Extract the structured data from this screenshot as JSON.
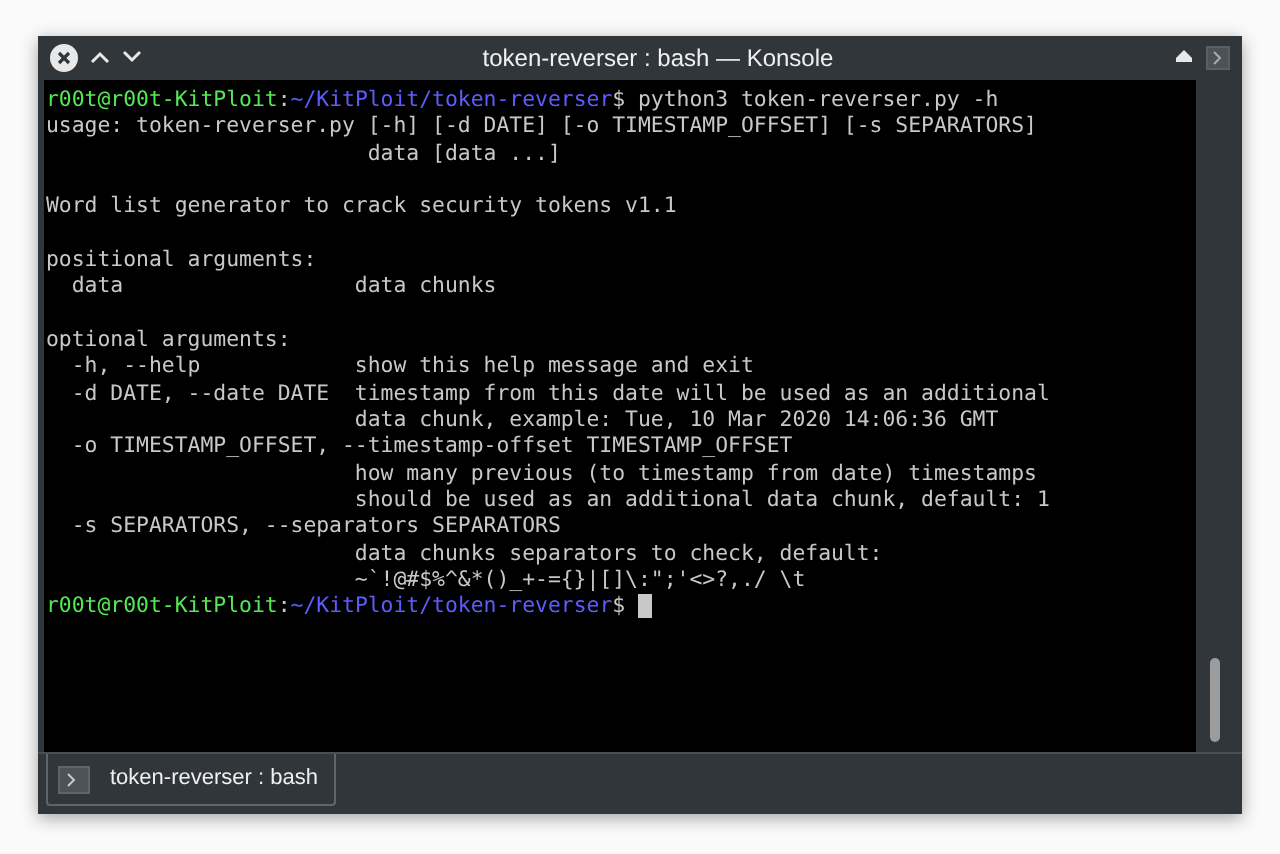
{
  "window": {
    "title": "token-reverser : bash — Konsole"
  },
  "terminal": {
    "lines": [
      {
        "kind": "prompt",
        "user_host": "r00t@r00t-KitPloit",
        "separator": ":",
        "path": "~/KitPloit/token-reverser",
        "prompt_end": "$",
        "command": "python3 token-reverser.py -h",
        "cursor": false
      },
      {
        "kind": "output",
        "text": "usage: token-reverser.py [-h] [-d DATE] [-o TIMESTAMP_OFFSET] [-s SEPARATORS]"
      },
      {
        "kind": "output",
        "text": "                         data [data ...]"
      },
      {
        "kind": "blank"
      },
      {
        "kind": "output",
        "text": "Word list generator to crack security tokens v1.1"
      },
      {
        "kind": "blank"
      },
      {
        "kind": "output",
        "text": "positional arguments:"
      },
      {
        "kind": "output",
        "text": "  data                  data chunks"
      },
      {
        "kind": "blank"
      },
      {
        "kind": "output",
        "text": "optional arguments:"
      },
      {
        "kind": "output",
        "text": "  -h, --help            show this help message and exit"
      },
      {
        "kind": "output",
        "text": "  -d DATE, --date DATE  timestamp from this date will be used as an additional"
      },
      {
        "kind": "output",
        "text": "                        data chunk, example: Tue, 10 Mar 2020 14:06:36 GMT"
      },
      {
        "kind": "output",
        "text": "  -o TIMESTAMP_OFFSET, --timestamp-offset TIMESTAMP_OFFSET"
      },
      {
        "kind": "output",
        "text": "                        how many previous (to timestamp from date) timestamps"
      },
      {
        "kind": "output",
        "text": "                        should be used as an additional data chunk, default: 1"
      },
      {
        "kind": "output",
        "text": "  -s SEPARATORS, --separators SEPARATORS"
      },
      {
        "kind": "output",
        "text": "                        data chunks separators to check, default:"
      },
      {
        "kind": "output",
        "text": "                        ~`!@#$%^&*()_+-={}|[]\\:\";'<>?,./ \\t"
      },
      {
        "kind": "prompt",
        "user_host": "r00t@r00t-KitPloit",
        "separator": ":",
        "path": "~/KitPloit/token-reverser",
        "prompt_end": "$",
        "cursor": true
      }
    ]
  },
  "tabs": [
    {
      "label": "token-reverser : bash",
      "selected": true
    }
  ]
}
